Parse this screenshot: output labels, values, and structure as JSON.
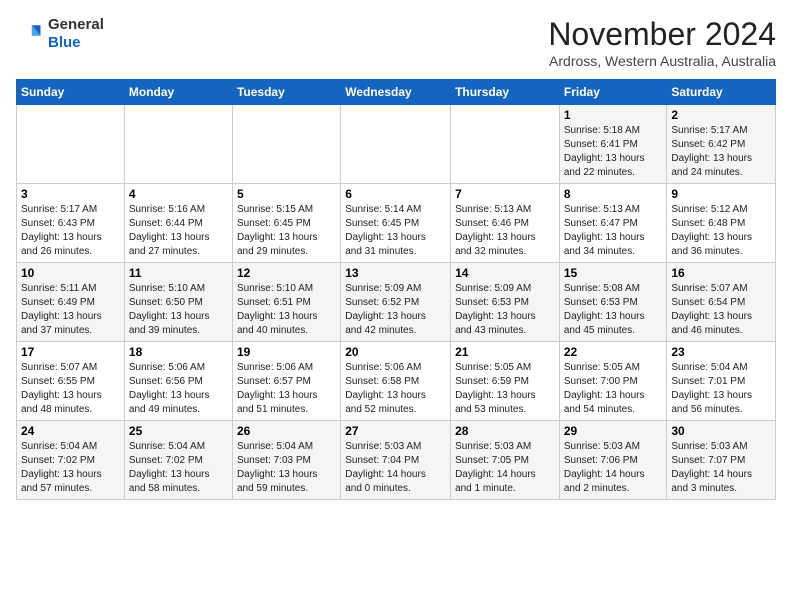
{
  "header": {
    "logo_general": "General",
    "logo_blue": "Blue",
    "month_title": "November 2024",
    "location": "Ardross, Western Australia, Australia"
  },
  "weekdays": [
    "Sunday",
    "Monday",
    "Tuesday",
    "Wednesday",
    "Thursday",
    "Friday",
    "Saturday"
  ],
  "weeks": [
    [
      {
        "day": "",
        "info": ""
      },
      {
        "day": "",
        "info": ""
      },
      {
        "day": "",
        "info": ""
      },
      {
        "day": "",
        "info": ""
      },
      {
        "day": "",
        "info": ""
      },
      {
        "day": "1",
        "info": "Sunrise: 5:18 AM\nSunset: 6:41 PM\nDaylight: 13 hours\nand 22 minutes."
      },
      {
        "day": "2",
        "info": "Sunrise: 5:17 AM\nSunset: 6:42 PM\nDaylight: 13 hours\nand 24 minutes."
      }
    ],
    [
      {
        "day": "3",
        "info": "Sunrise: 5:17 AM\nSunset: 6:43 PM\nDaylight: 13 hours\nand 26 minutes."
      },
      {
        "day": "4",
        "info": "Sunrise: 5:16 AM\nSunset: 6:44 PM\nDaylight: 13 hours\nand 27 minutes."
      },
      {
        "day": "5",
        "info": "Sunrise: 5:15 AM\nSunset: 6:45 PM\nDaylight: 13 hours\nand 29 minutes."
      },
      {
        "day": "6",
        "info": "Sunrise: 5:14 AM\nSunset: 6:45 PM\nDaylight: 13 hours\nand 31 minutes."
      },
      {
        "day": "7",
        "info": "Sunrise: 5:13 AM\nSunset: 6:46 PM\nDaylight: 13 hours\nand 32 minutes."
      },
      {
        "day": "8",
        "info": "Sunrise: 5:13 AM\nSunset: 6:47 PM\nDaylight: 13 hours\nand 34 minutes."
      },
      {
        "day": "9",
        "info": "Sunrise: 5:12 AM\nSunset: 6:48 PM\nDaylight: 13 hours\nand 36 minutes."
      }
    ],
    [
      {
        "day": "10",
        "info": "Sunrise: 5:11 AM\nSunset: 6:49 PM\nDaylight: 13 hours\nand 37 minutes."
      },
      {
        "day": "11",
        "info": "Sunrise: 5:10 AM\nSunset: 6:50 PM\nDaylight: 13 hours\nand 39 minutes."
      },
      {
        "day": "12",
        "info": "Sunrise: 5:10 AM\nSunset: 6:51 PM\nDaylight: 13 hours\nand 40 minutes."
      },
      {
        "day": "13",
        "info": "Sunrise: 5:09 AM\nSunset: 6:52 PM\nDaylight: 13 hours\nand 42 minutes."
      },
      {
        "day": "14",
        "info": "Sunrise: 5:09 AM\nSunset: 6:53 PM\nDaylight: 13 hours\nand 43 minutes."
      },
      {
        "day": "15",
        "info": "Sunrise: 5:08 AM\nSunset: 6:53 PM\nDaylight: 13 hours\nand 45 minutes."
      },
      {
        "day": "16",
        "info": "Sunrise: 5:07 AM\nSunset: 6:54 PM\nDaylight: 13 hours\nand 46 minutes."
      }
    ],
    [
      {
        "day": "17",
        "info": "Sunrise: 5:07 AM\nSunset: 6:55 PM\nDaylight: 13 hours\nand 48 minutes."
      },
      {
        "day": "18",
        "info": "Sunrise: 5:06 AM\nSunset: 6:56 PM\nDaylight: 13 hours\nand 49 minutes."
      },
      {
        "day": "19",
        "info": "Sunrise: 5:06 AM\nSunset: 6:57 PM\nDaylight: 13 hours\nand 51 minutes."
      },
      {
        "day": "20",
        "info": "Sunrise: 5:06 AM\nSunset: 6:58 PM\nDaylight: 13 hours\nand 52 minutes."
      },
      {
        "day": "21",
        "info": "Sunrise: 5:05 AM\nSunset: 6:59 PM\nDaylight: 13 hours\nand 53 minutes."
      },
      {
        "day": "22",
        "info": "Sunrise: 5:05 AM\nSunset: 7:00 PM\nDaylight: 13 hours\nand 54 minutes."
      },
      {
        "day": "23",
        "info": "Sunrise: 5:04 AM\nSunset: 7:01 PM\nDaylight: 13 hours\nand 56 minutes."
      }
    ],
    [
      {
        "day": "24",
        "info": "Sunrise: 5:04 AM\nSunset: 7:02 PM\nDaylight: 13 hours\nand 57 minutes."
      },
      {
        "day": "25",
        "info": "Sunrise: 5:04 AM\nSunset: 7:02 PM\nDaylight: 13 hours\nand 58 minutes."
      },
      {
        "day": "26",
        "info": "Sunrise: 5:04 AM\nSunset: 7:03 PM\nDaylight: 13 hours\nand 59 minutes."
      },
      {
        "day": "27",
        "info": "Sunrise: 5:03 AM\nSunset: 7:04 PM\nDaylight: 14 hours\nand 0 minutes."
      },
      {
        "day": "28",
        "info": "Sunrise: 5:03 AM\nSunset: 7:05 PM\nDaylight: 14 hours\nand 1 minute."
      },
      {
        "day": "29",
        "info": "Sunrise: 5:03 AM\nSunset: 7:06 PM\nDaylight: 14 hours\nand 2 minutes."
      },
      {
        "day": "30",
        "info": "Sunrise: 5:03 AM\nSunset: 7:07 PM\nDaylight: 14 hours\nand 3 minutes."
      }
    ]
  ]
}
